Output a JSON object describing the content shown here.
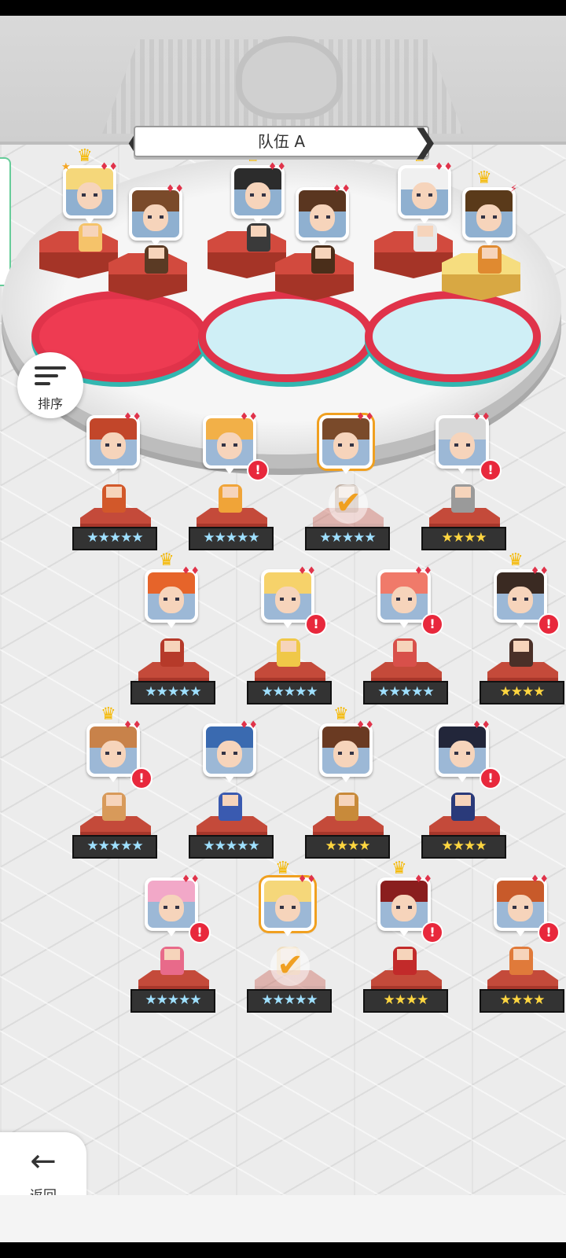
{
  "team": {
    "title": "队伍 A",
    "prev_label": "❮",
    "next_label": "❯"
  },
  "controls": {
    "sort_label": "排序",
    "back_label": "返回",
    "back_icon": "←"
  },
  "colors": {
    "accent_red": "#e0334a",
    "crown_gold": "#f5b800",
    "select_orange": "#f0a020"
  },
  "team_slots": [
    {
      "crown": true,
      "leader_star": true,
      "suit": "♦♦",
      "face_color": "#f5d77a",
      "sprite_color": "#f5c36a",
      "cake": "red"
    },
    {
      "crown": false,
      "suit": "♦♦",
      "face_color": "#7a4a2a",
      "sprite_color": "#5a3a24",
      "cake": "red"
    },
    {
      "crown": true,
      "suit": "♦♦",
      "face_color": "#2c2c2c",
      "sprite_color": "#3a3a3a",
      "cake": "red"
    },
    {
      "crown": false,
      "suit": "♦♦",
      "face_color": "#5a3620",
      "sprite_color": "#4a2e1a",
      "cake": "red"
    },
    {
      "crown": true,
      "suit": "♦♦",
      "face_color": "#f0f0f0",
      "sprite_color": "#e8e8e8",
      "cake": "red"
    },
    {
      "crown": true,
      "suit": "⚡",
      "face_color": "#5a3a1a",
      "sprite_color": "#e08a30",
      "cake": "gold"
    }
  ],
  "roster": [
    {
      "stars": "★★★★★",
      "star_style": "blue",
      "crown": false,
      "alert": false,
      "selected": false,
      "face_color": "#c2462a",
      "sprite_color": "#d2582a"
    },
    {
      "stars": "★★★★★",
      "star_style": "blue",
      "crown": false,
      "alert": true,
      "selected": false,
      "face_color": "#f2b048",
      "sprite_color": "#f0a438"
    },
    {
      "stars": "★★★★★",
      "star_style": "blue",
      "crown": false,
      "alert": false,
      "selected": true,
      "face_color": "#7a4a2a",
      "sprite_color": "#7a4a2a"
    },
    {
      "stars": "★★★★",
      "star_style": "gold",
      "crown": false,
      "alert": true,
      "selected": false,
      "face_color": "#d8d8d8",
      "sprite_color": "#9a9a9a"
    },
    {
      "stars": "★★★★★",
      "star_style": "blue",
      "crown": true,
      "alert": false,
      "selected": false,
      "face_color": "#e6642a",
      "sprite_color": "#b63a2a"
    },
    {
      "stars": "★★★★★",
      "star_style": "blue",
      "crown": false,
      "alert": true,
      "selected": false,
      "face_color": "#f6d26a",
      "sprite_color": "#f0c848"
    },
    {
      "stars": "★★★★★",
      "star_style": "blue",
      "crown": false,
      "alert": true,
      "selected": false,
      "face_color": "#f07a6a",
      "sprite_color": "#d8504a"
    },
    {
      "stars": "★★★★",
      "star_style": "gold",
      "crown": true,
      "alert": true,
      "selected": false,
      "face_color": "#3a2a22",
      "sprite_color": "#4a3028"
    },
    {
      "stars": "★★★★★",
      "star_style": "blue",
      "crown": true,
      "alert": true,
      "selected": false,
      "face_color": "#c8824a",
      "sprite_color": "#d89a5a"
    },
    {
      "stars": "★★★★★",
      "star_style": "blue",
      "crown": false,
      "alert": false,
      "selected": false,
      "face_color": "#3a6ab0",
      "sprite_color": "#3a5ab0"
    },
    {
      "stars": "★★★★",
      "star_style": "gold",
      "crown": true,
      "alert": false,
      "selected": false,
      "face_color": "#6a3a22",
      "sprite_color": "#c88a3a"
    },
    {
      "stars": "★★★★",
      "star_style": "gold",
      "crown": false,
      "alert": true,
      "selected": false,
      "face_color": "#22263a",
      "sprite_color": "#2a3a7a"
    },
    {
      "stars": "★★★★★",
      "star_style": "blue",
      "crown": false,
      "alert": true,
      "selected": false,
      "face_color": "#f2a8c8",
      "sprite_color": "#e86a8a"
    },
    {
      "stars": "★★★★★",
      "star_style": "blue",
      "crown": true,
      "alert": false,
      "selected": true,
      "face_color": "#f5d77a",
      "sprite_color": "#f5c36a"
    },
    {
      "stars": "★★★★",
      "star_style": "gold",
      "crown": true,
      "alert": true,
      "selected": false,
      "face_color": "#8a1e1e",
      "sprite_color": "#c22a2a"
    },
    {
      "stars": "★★★★",
      "star_style": "gold",
      "crown": false,
      "alert": true,
      "selected": false,
      "face_color": "#c85a2a",
      "sprite_color": "#e07a3a"
    }
  ]
}
